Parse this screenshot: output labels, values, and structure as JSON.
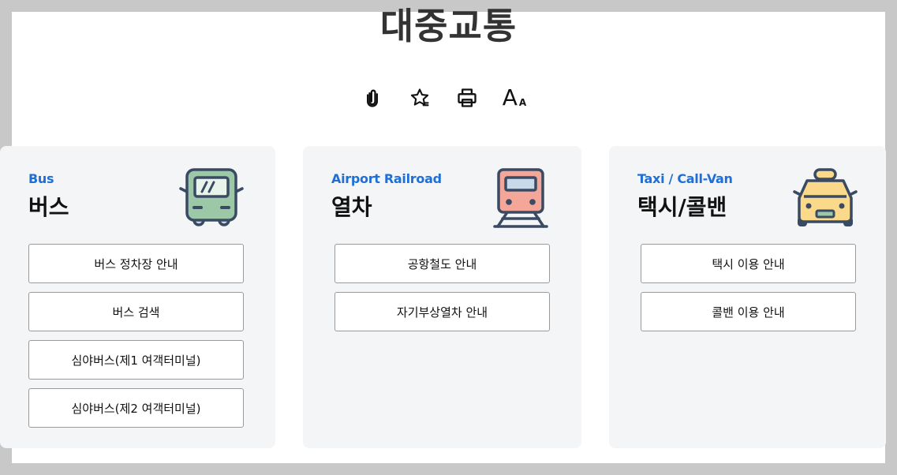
{
  "page": {
    "title": "대중교통"
  },
  "toolbar": {
    "items": [
      {
        "icon": "paperclip-icon"
      },
      {
        "icon": "star-icon"
      },
      {
        "icon": "print-icon"
      },
      {
        "icon": "font-size-icon",
        "big": "A",
        "small": "A"
      }
    ]
  },
  "cards": {
    "bus": {
      "en": "Bus",
      "ko": "버스",
      "icon": "bus-icon",
      "buttons": [
        "버스 정차장 안내",
        "버스 검색",
        "심야버스(제1 여객터미널)",
        "심야버스(제2 여객터미널)"
      ]
    },
    "rail": {
      "en": "Airport Railroad",
      "ko": "열차",
      "icon": "train-icon",
      "buttons": [
        "공항철도 안내",
        "자기부상열차 안내"
      ]
    },
    "taxi": {
      "en": "Taxi / Call-Van",
      "ko": "택시/콜밴",
      "icon": "taxi-icon",
      "buttons": [
        "택시 이용 안내",
        "콜밴 이용 안내"
      ]
    }
  },
  "colors": {
    "accent": "#1f6fd6",
    "card_bg": "#f4f5f7",
    "bus_green": "#9cc8a8",
    "train_red": "#f4a699",
    "taxi_yellow": "#fbd98a",
    "icon_stroke": "#3a4a63"
  }
}
